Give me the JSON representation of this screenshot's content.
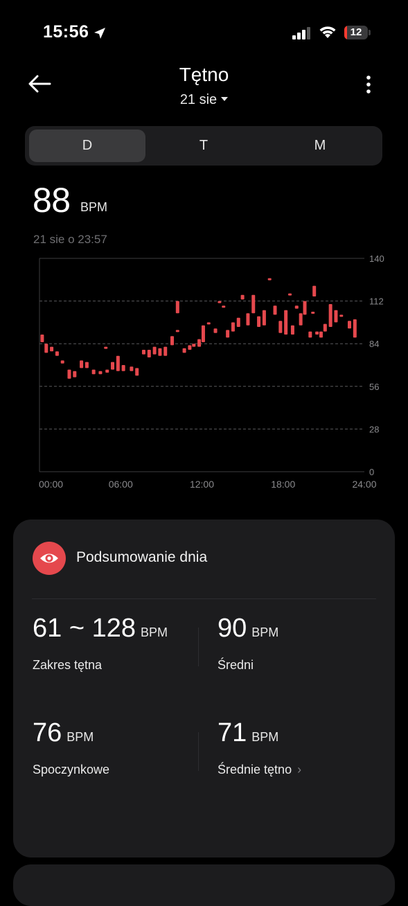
{
  "status_bar": {
    "time": "15:56",
    "battery": "12",
    "icons": [
      "location-arrow-icon",
      "cellular-signal-icon",
      "wifi-icon",
      "battery-icon"
    ]
  },
  "header": {
    "title": "Tętno",
    "date": "21 sie",
    "back_icon": "back-arrow-icon",
    "more_icon": "more-vertical-icon"
  },
  "tabs": [
    {
      "label": "D",
      "active": true
    },
    {
      "label": "T",
      "active": false
    },
    {
      "label": "M",
      "active": false
    }
  ],
  "current": {
    "value": "88",
    "unit": "BPM",
    "timestamp": "21 sie o 23:57"
  },
  "chart_data": {
    "type": "bar",
    "subtype": "range-candles",
    "color": "#e5484d",
    "x_ticks": [
      "00:00",
      "06:00",
      "12:00",
      "18:00",
      "24:00"
    ],
    "y_ticks": [
      "0",
      "28",
      "56",
      "84",
      "112",
      "140"
    ],
    "xlim": [
      0,
      24
    ],
    "ylim": [
      0,
      140
    ],
    "grid": "dashed horizontal",
    "ranges": [
      [
        0.2,
        85,
        90
      ],
      [
        0.5,
        78,
        84
      ],
      [
        0.9,
        79,
        82
      ],
      [
        1.3,
        76,
        79
      ],
      [
        1.7,
        71,
        73
      ],
      [
        2.2,
        61,
        67
      ],
      [
        2.6,
        62,
        66
      ],
      [
        3.1,
        68,
        73
      ],
      [
        3.5,
        68,
        72
      ],
      [
        4.0,
        64,
        67
      ],
      [
        4.5,
        64,
        66
      ],
      [
        4.9,
        81,
        82
      ],
      [
        5.0,
        65,
        67
      ],
      [
        5.4,
        67,
        72
      ],
      [
        5.8,
        66,
        76
      ],
      [
        6.2,
        66,
        70
      ],
      [
        6.8,
        66,
        69
      ],
      [
        7.2,
        63,
        68
      ],
      [
        7.7,
        77,
        80
      ],
      [
        8.1,
        75,
        80
      ],
      [
        8.5,
        77,
        82
      ],
      [
        8.9,
        76,
        81
      ],
      [
        9.3,
        76,
        82
      ],
      [
        9.8,
        83,
        89
      ],
      [
        10.2,
        104,
        112
      ],
      [
        10.2,
        92,
        93
      ],
      [
        10.7,
        78,
        81
      ],
      [
        11.1,
        80,
        83
      ],
      [
        11.4,
        82,
        84
      ],
      [
        11.8,
        82,
        87
      ],
      [
        12.1,
        85,
        96
      ],
      [
        12.5,
        97,
        98
      ],
      [
        13.0,
        91,
        94
      ],
      [
        13.3,
        111,
        112
      ],
      [
        13.6,
        108,
        109
      ],
      [
        13.9,
        88,
        93
      ],
      [
        14.3,
        92,
        98
      ],
      [
        14.7,
        95,
        101
      ],
      [
        15.0,
        113,
        116
      ],
      [
        15.4,
        96,
        104
      ],
      [
        15.8,
        104,
        116
      ],
      [
        16.2,
        95,
        102
      ],
      [
        16.6,
        96,
        106
      ],
      [
        17.0,
        126,
        127
      ],
      [
        17.4,
        103,
        109
      ],
      [
        17.8,
        91,
        99
      ],
      [
        18.2,
        90,
        106
      ],
      [
        18.5,
        116,
        117
      ],
      [
        18.7,
        90,
        96
      ],
      [
        19.0,
        107,
        109
      ],
      [
        19.3,
        96,
        104
      ],
      [
        19.6,
        103,
        112
      ],
      [
        20.0,
        88,
        92
      ],
      [
        20.2,
        104,
        105
      ],
      [
        20.5,
        90,
        92
      ],
      [
        20.8,
        88,
        92
      ],
      [
        20.3,
        115,
        122
      ],
      [
        21.1,
        92,
        97
      ],
      [
        21.5,
        95,
        110
      ],
      [
        21.9,
        98,
        106
      ],
      [
        22.3,
        102,
        103
      ],
      [
        22.9,
        94,
        99
      ],
      [
        23.3,
        88,
        100
      ]
    ]
  },
  "summary": {
    "icon": "eye-icon",
    "title": "Podsumowanie dnia",
    "stats": [
      {
        "value": "61 ~ 128",
        "unit": "BPM",
        "label": "Zakres tętna"
      },
      {
        "value": "90",
        "unit": "BPM",
        "label": "Średni"
      },
      {
        "value": "76",
        "unit": "BPM",
        "label": "Spoczynkowe"
      },
      {
        "value": "71",
        "unit": "BPM",
        "label": "Średnie tętno",
        "chevron": "chevron-right-icon"
      }
    ]
  }
}
